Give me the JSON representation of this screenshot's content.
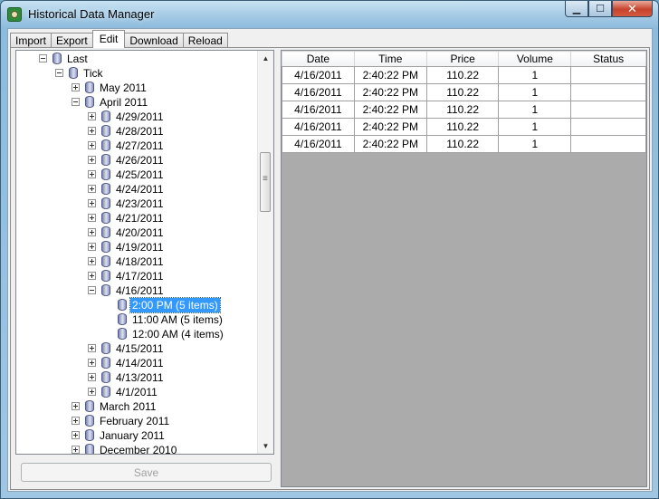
{
  "window": {
    "title": "Historical Data Manager",
    "controls": {
      "minimize": "▁",
      "maximize": "☐",
      "close": "✕"
    },
    "app_icon": "green-app-icon"
  },
  "tabs": [
    {
      "label": "Import"
    },
    {
      "label": "Export"
    },
    {
      "label": "Edit",
      "active": true
    },
    {
      "label": "Download"
    },
    {
      "label": "Reload"
    }
  ],
  "tree": {
    "nodes": [
      {
        "label": "Last",
        "level": 0,
        "expander": "minus"
      },
      {
        "label": "Tick",
        "level": 1,
        "expander": "minus"
      },
      {
        "label": "May 2011",
        "level": 2,
        "expander": "plus"
      },
      {
        "label": "April 2011",
        "level": 2,
        "expander": "minus"
      },
      {
        "label": "4/29/2011",
        "level": 3,
        "expander": "plus"
      },
      {
        "label": "4/28/2011",
        "level": 3,
        "expander": "plus"
      },
      {
        "label": "4/27/2011",
        "level": 3,
        "expander": "plus"
      },
      {
        "label": "4/26/2011",
        "level": 3,
        "expander": "plus"
      },
      {
        "label": "4/25/2011",
        "level": 3,
        "expander": "plus"
      },
      {
        "label": "4/24/2011",
        "level": 3,
        "expander": "plus"
      },
      {
        "label": "4/23/2011",
        "level": 3,
        "expander": "plus"
      },
      {
        "label": "4/21/2011",
        "level": 3,
        "expander": "plus"
      },
      {
        "label": "4/20/2011",
        "level": 3,
        "expander": "plus"
      },
      {
        "label": "4/19/2011",
        "level": 3,
        "expander": "plus"
      },
      {
        "label": "4/18/2011",
        "level": 3,
        "expander": "plus"
      },
      {
        "label": "4/17/2011",
        "level": 3,
        "expander": "plus"
      },
      {
        "label": "4/16/2011",
        "level": 3,
        "expander": "minus"
      },
      {
        "label": "2:00 PM (5 items)",
        "level": 4,
        "expander": "none",
        "selected": true
      },
      {
        "label": "11:00 AM (5 items)",
        "level": 4,
        "expander": "none"
      },
      {
        "label": "12:00 AM (4 items)",
        "level": 4,
        "expander": "none"
      },
      {
        "label": "4/15/2011",
        "level": 3,
        "expander": "plus"
      },
      {
        "label": "4/14/2011",
        "level": 3,
        "expander": "plus"
      },
      {
        "label": "4/13/2011",
        "level": 3,
        "expander": "plus"
      },
      {
        "label": "4/1/2011",
        "level": 3,
        "expander": "plus"
      },
      {
        "label": "March 2011",
        "level": 2,
        "expander": "plus"
      },
      {
        "label": "February 2011",
        "level": 2,
        "expander": "plus"
      },
      {
        "label": "January 2011",
        "level": 2,
        "expander": "plus"
      },
      {
        "label": "December 2010",
        "level": 2,
        "expander": "plus"
      }
    ],
    "scroll_up": "▲",
    "scroll_down": "▼"
  },
  "save_button": {
    "label": "Save",
    "enabled": false
  },
  "grid": {
    "columns": [
      "Date",
      "Time",
      "Price",
      "Volume",
      "Status"
    ],
    "rows": [
      [
        "4/16/2011",
        "2:40:22 PM",
        "110.22",
        "1",
        ""
      ],
      [
        "4/16/2011",
        "2:40:22 PM",
        "110.22",
        "1",
        ""
      ],
      [
        "4/16/2011",
        "2:40:22 PM",
        "110.22",
        "1",
        ""
      ],
      [
        "4/16/2011",
        "2:40:22 PM",
        "110.22",
        "1",
        ""
      ],
      [
        "4/16/2011",
        "2:40:22 PM",
        "110.22",
        "1",
        ""
      ]
    ]
  }
}
